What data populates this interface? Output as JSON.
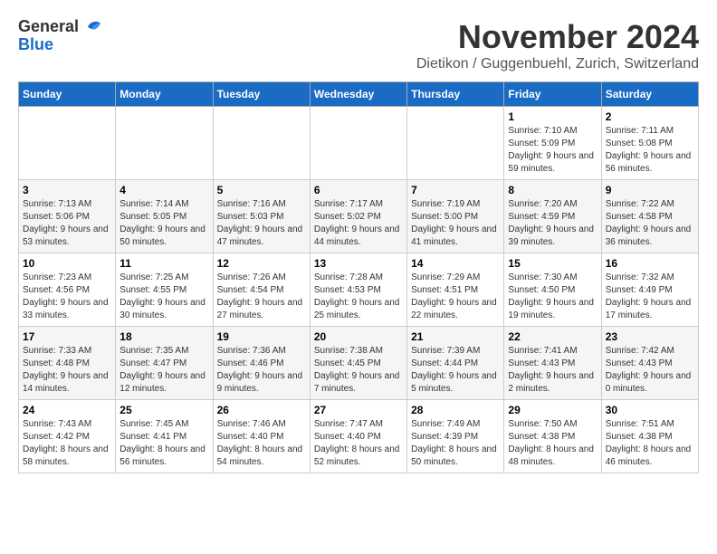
{
  "logo": {
    "line1": "General",
    "line2": "Blue"
  },
  "title": "November 2024",
  "location": "Dietikon / Guggenbuehl, Zurich, Switzerland",
  "days_of_week": [
    "Sunday",
    "Monday",
    "Tuesday",
    "Wednesday",
    "Thursday",
    "Friday",
    "Saturday"
  ],
  "weeks": [
    [
      {
        "day": "",
        "info": ""
      },
      {
        "day": "",
        "info": ""
      },
      {
        "day": "",
        "info": ""
      },
      {
        "day": "",
        "info": ""
      },
      {
        "day": "",
        "info": ""
      },
      {
        "day": "1",
        "info": "Sunrise: 7:10 AM\nSunset: 5:09 PM\nDaylight: 9 hours and 59 minutes."
      },
      {
        "day": "2",
        "info": "Sunrise: 7:11 AM\nSunset: 5:08 PM\nDaylight: 9 hours and 56 minutes."
      }
    ],
    [
      {
        "day": "3",
        "info": "Sunrise: 7:13 AM\nSunset: 5:06 PM\nDaylight: 9 hours and 53 minutes."
      },
      {
        "day": "4",
        "info": "Sunrise: 7:14 AM\nSunset: 5:05 PM\nDaylight: 9 hours and 50 minutes."
      },
      {
        "day": "5",
        "info": "Sunrise: 7:16 AM\nSunset: 5:03 PM\nDaylight: 9 hours and 47 minutes."
      },
      {
        "day": "6",
        "info": "Sunrise: 7:17 AM\nSunset: 5:02 PM\nDaylight: 9 hours and 44 minutes."
      },
      {
        "day": "7",
        "info": "Sunrise: 7:19 AM\nSunset: 5:00 PM\nDaylight: 9 hours and 41 minutes."
      },
      {
        "day": "8",
        "info": "Sunrise: 7:20 AM\nSunset: 4:59 PM\nDaylight: 9 hours and 39 minutes."
      },
      {
        "day": "9",
        "info": "Sunrise: 7:22 AM\nSunset: 4:58 PM\nDaylight: 9 hours and 36 minutes."
      }
    ],
    [
      {
        "day": "10",
        "info": "Sunrise: 7:23 AM\nSunset: 4:56 PM\nDaylight: 9 hours and 33 minutes."
      },
      {
        "day": "11",
        "info": "Sunrise: 7:25 AM\nSunset: 4:55 PM\nDaylight: 9 hours and 30 minutes."
      },
      {
        "day": "12",
        "info": "Sunrise: 7:26 AM\nSunset: 4:54 PM\nDaylight: 9 hours and 27 minutes."
      },
      {
        "day": "13",
        "info": "Sunrise: 7:28 AM\nSunset: 4:53 PM\nDaylight: 9 hours and 25 minutes."
      },
      {
        "day": "14",
        "info": "Sunrise: 7:29 AM\nSunset: 4:51 PM\nDaylight: 9 hours and 22 minutes."
      },
      {
        "day": "15",
        "info": "Sunrise: 7:30 AM\nSunset: 4:50 PM\nDaylight: 9 hours and 19 minutes."
      },
      {
        "day": "16",
        "info": "Sunrise: 7:32 AM\nSunset: 4:49 PM\nDaylight: 9 hours and 17 minutes."
      }
    ],
    [
      {
        "day": "17",
        "info": "Sunrise: 7:33 AM\nSunset: 4:48 PM\nDaylight: 9 hours and 14 minutes."
      },
      {
        "day": "18",
        "info": "Sunrise: 7:35 AM\nSunset: 4:47 PM\nDaylight: 9 hours and 12 minutes."
      },
      {
        "day": "19",
        "info": "Sunrise: 7:36 AM\nSunset: 4:46 PM\nDaylight: 9 hours and 9 minutes."
      },
      {
        "day": "20",
        "info": "Sunrise: 7:38 AM\nSunset: 4:45 PM\nDaylight: 9 hours and 7 minutes."
      },
      {
        "day": "21",
        "info": "Sunrise: 7:39 AM\nSunset: 4:44 PM\nDaylight: 9 hours and 5 minutes."
      },
      {
        "day": "22",
        "info": "Sunrise: 7:41 AM\nSunset: 4:43 PM\nDaylight: 9 hours and 2 minutes."
      },
      {
        "day": "23",
        "info": "Sunrise: 7:42 AM\nSunset: 4:43 PM\nDaylight: 9 hours and 0 minutes."
      }
    ],
    [
      {
        "day": "24",
        "info": "Sunrise: 7:43 AM\nSunset: 4:42 PM\nDaylight: 8 hours and 58 minutes."
      },
      {
        "day": "25",
        "info": "Sunrise: 7:45 AM\nSunset: 4:41 PM\nDaylight: 8 hours and 56 minutes."
      },
      {
        "day": "26",
        "info": "Sunrise: 7:46 AM\nSunset: 4:40 PM\nDaylight: 8 hours and 54 minutes."
      },
      {
        "day": "27",
        "info": "Sunrise: 7:47 AM\nSunset: 4:40 PM\nDaylight: 8 hours and 52 minutes."
      },
      {
        "day": "28",
        "info": "Sunrise: 7:49 AM\nSunset: 4:39 PM\nDaylight: 8 hours and 50 minutes."
      },
      {
        "day": "29",
        "info": "Sunrise: 7:50 AM\nSunset: 4:38 PM\nDaylight: 8 hours and 48 minutes."
      },
      {
        "day": "30",
        "info": "Sunrise: 7:51 AM\nSunset: 4:38 PM\nDaylight: 8 hours and 46 minutes."
      }
    ]
  ]
}
